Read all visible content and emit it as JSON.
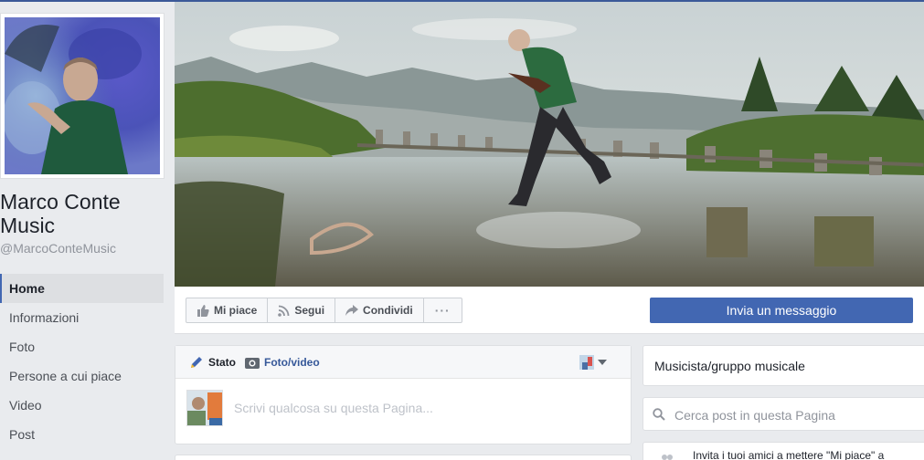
{
  "page": {
    "name": "Marco Conte Music",
    "handle": "@MarcoConteMusic"
  },
  "nav": {
    "items": [
      {
        "label": "Home",
        "active": true
      },
      {
        "label": "Informazioni"
      },
      {
        "label": "Foto"
      },
      {
        "label": "Persone a cui piace"
      },
      {
        "label": "Video"
      },
      {
        "label": "Post"
      }
    ]
  },
  "actions": {
    "like": "Mi piace",
    "follow": "Segui",
    "share": "Condividi",
    "more": "···",
    "message": "Invia un messaggio"
  },
  "composer": {
    "tab_status": "Stato",
    "tab_photo": "Foto/video",
    "placeholder": "Scrivi qualcosa su questa Pagina..."
  },
  "sidebar": {
    "category": "Musicista/gruppo musicale",
    "search_placeholder": "Cerca post in questa Pagina",
    "invite_text": "Invita i tuoi amici a mettere \"Mi piace\" a"
  },
  "colors": {
    "brand": "#3b5998",
    "button_primary": "#4267b2",
    "background": "#e9ebee"
  }
}
